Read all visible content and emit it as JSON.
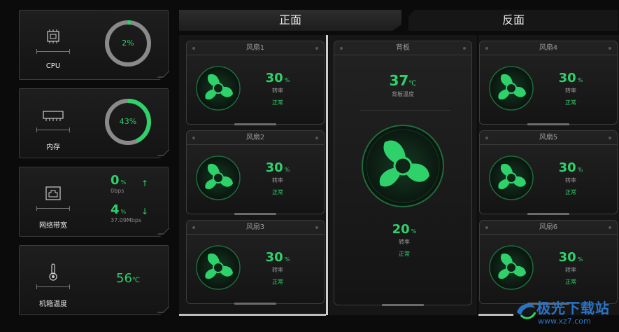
{
  "stats": {
    "cpu": {
      "label": "CPU",
      "percent": 2,
      "value_text": "2%"
    },
    "memory": {
      "label": "内存",
      "percent": 43,
      "value_text": "43%"
    },
    "network": {
      "label": "网络带宽",
      "up_value": "0",
      "up_unit": "%",
      "up_rate": "0bps",
      "down_value": "4",
      "down_unit": "%",
      "down_rate": "37.09Mbps",
      "up_arrow": "↑",
      "down_arrow": "↓"
    },
    "chassis": {
      "label": "机箱温度",
      "value": "56",
      "unit": "℃"
    }
  },
  "tabs": {
    "front": "正面",
    "back": "反面"
  },
  "fans": [
    {
      "title": "风扇1",
      "value": "30",
      "unit": "%",
      "label": "转率",
      "status": "正常"
    },
    {
      "title": "风扇2",
      "value": "30",
      "unit": "%",
      "label": "转率",
      "status": "正常"
    },
    {
      "title": "风扇3",
      "value": "30",
      "unit": "%",
      "label": "转率",
      "status": "正常"
    },
    {
      "title": "风扇4",
      "value": "30",
      "unit": "%",
      "label": "转率",
      "status": "正常"
    },
    {
      "title": "风扇5",
      "value": "30",
      "unit": "%",
      "label": "转率",
      "status": "正常"
    },
    {
      "title": "风扇6",
      "value": "30",
      "unit": "%",
      "label": "转率",
      "status": "正常"
    }
  ],
  "backplate": {
    "title": "背板",
    "temp": "37",
    "temp_unit": "℃",
    "temp_label": "背板温度",
    "value": "20",
    "unit": "%",
    "label": "转率",
    "status": "正常"
  },
  "watermark": {
    "title": "极光下载站",
    "url": "www.xz7.com"
  },
  "colors": {
    "accent": "#2fd16b",
    "ring_track": "#8a8a8a",
    "watermark": "#2b73c6"
  }
}
